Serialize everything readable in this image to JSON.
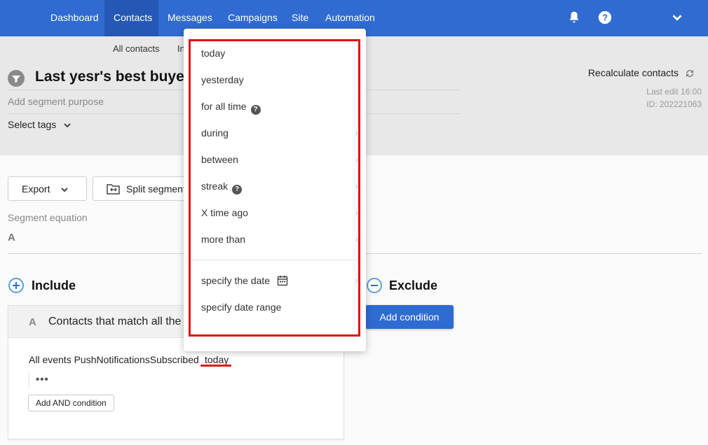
{
  "nav": {
    "items": [
      "Dashboard",
      "Contacts",
      "Messages",
      "Campaigns",
      "Site",
      "Automation"
    ],
    "active": "Contacts",
    "icons": [
      "bell-icon",
      "help-icon",
      "chevron-down-icon"
    ]
  },
  "subnav": {
    "all_contacts": "All contacts",
    "partial": "In"
  },
  "segment": {
    "title": "Last yesr's best buyers",
    "purpose_placeholder": "Add segment purpose",
    "select_tags": "Select tags",
    "recalculate": "Recalculate contacts",
    "last_edit": "Last edit 16:00",
    "id": "ID:  202221063"
  },
  "toolbar": {
    "export": "Export",
    "split": "Split segment"
  },
  "equation": {
    "label": "Segment equation",
    "value": "A"
  },
  "include": {
    "title": "Include",
    "card_letter": "A",
    "card_heading": "Contacts that match all the",
    "condition": "All events PushNotificationsSubscribed",
    "condition_value": "today",
    "ellipsis": "•••",
    "add_and": "Add AND condition"
  },
  "exclude": {
    "title": "Exclude",
    "add_condition": "Add condition"
  },
  "dropdown": {
    "items": [
      "today",
      "yesterday",
      "for all time",
      "during",
      "between",
      "streak",
      "X time ago",
      "more than",
      "specify the date",
      "specify date range"
    ],
    "help_glyph": "?"
  },
  "colors": {
    "brand": "#2f6bd1",
    "highlight": "#e01010"
  }
}
